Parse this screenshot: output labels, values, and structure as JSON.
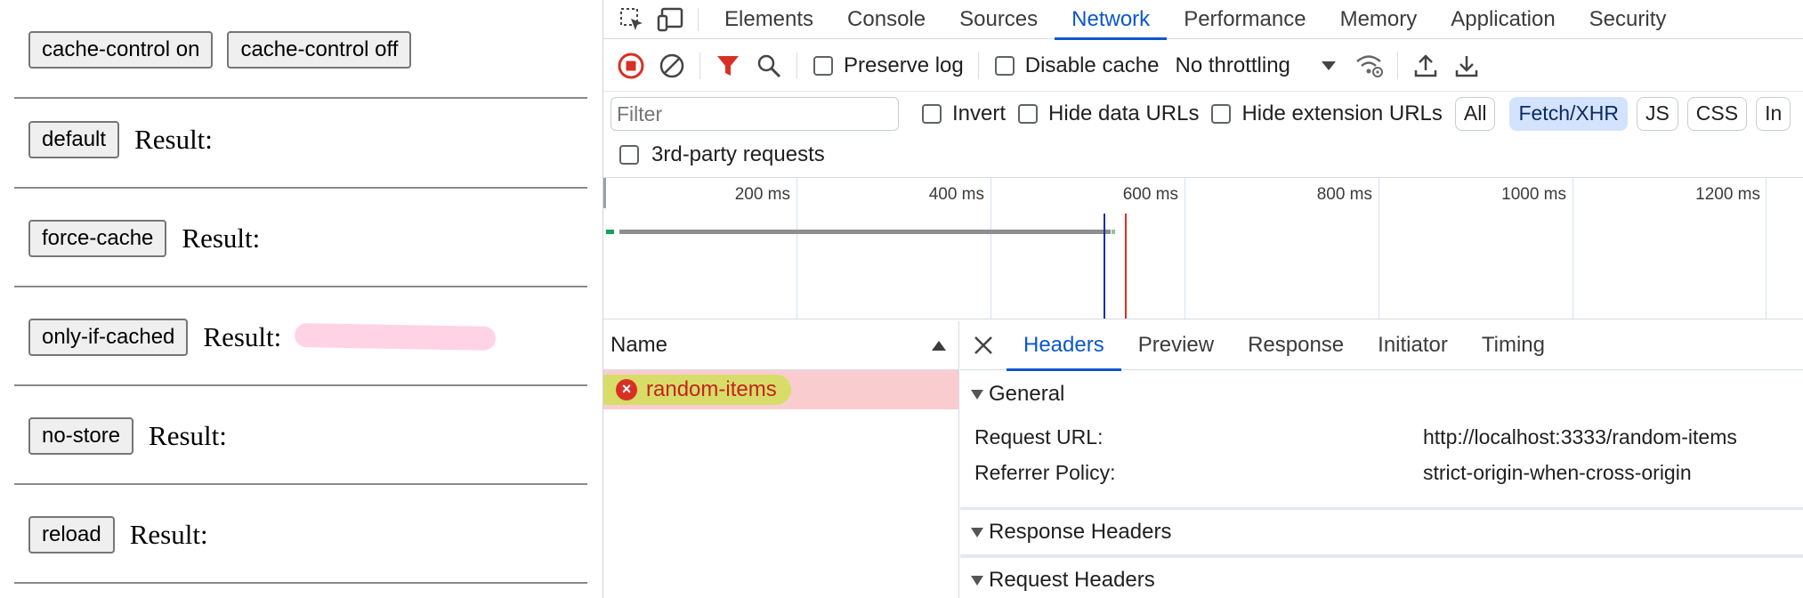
{
  "page": {
    "top_buttons": {
      "on_label": "cache-control on",
      "off_label": "cache-control off"
    },
    "rows": [
      {
        "button": "default",
        "result_label": "Result:"
      },
      {
        "button": "force-cache",
        "result_label": "Result:"
      },
      {
        "button": "only-if-cached",
        "result_label": "Result:"
      },
      {
        "button": "no-store",
        "result_label": "Result:"
      },
      {
        "button": "reload",
        "result_label": "Result:"
      }
    ]
  },
  "devtools": {
    "tabs": [
      "Elements",
      "Console",
      "Sources",
      "Network",
      "Performance",
      "Memory",
      "Application",
      "Security"
    ],
    "active_tab": "Network",
    "toolbar": {
      "preserve_log": "Preserve log",
      "disable_cache": "Disable cache",
      "throttling": "No throttling"
    },
    "filter": {
      "placeholder": "Filter",
      "invert": "Invert",
      "hide_data_urls": "Hide data URLs",
      "hide_extension_urls": "Hide extension URLs",
      "chips": [
        "All",
        "Fetch/XHR",
        "JS",
        "CSS",
        "In"
      ],
      "active_chip": "Fetch/XHR",
      "third_party": "3rd-party requests"
    },
    "timeline": {
      "ticks": [
        "200 ms",
        "400 ms",
        "600 ms",
        "800 ms",
        "1000 ms",
        "1200 ms"
      ],
      "colors": {
        "dom_content_loaded": "#1a2fa0",
        "load": "#d93025"
      }
    },
    "requests": {
      "name_header": "Name",
      "items": [
        {
          "name": "random-items",
          "status": "error"
        }
      ]
    },
    "details": {
      "tabs": [
        "Headers",
        "Preview",
        "Response",
        "Initiator",
        "Timing"
      ],
      "active_tab": "Headers",
      "general": {
        "title": "General",
        "request_url_label": "Request URL:",
        "request_url": "http://localhost:3333/random-items",
        "referrer_policy_label": "Referrer Policy:",
        "referrer_policy": "strict-origin-when-cross-origin"
      },
      "response_headers": "Response Headers",
      "request_headers": "Request Headers"
    }
  }
}
